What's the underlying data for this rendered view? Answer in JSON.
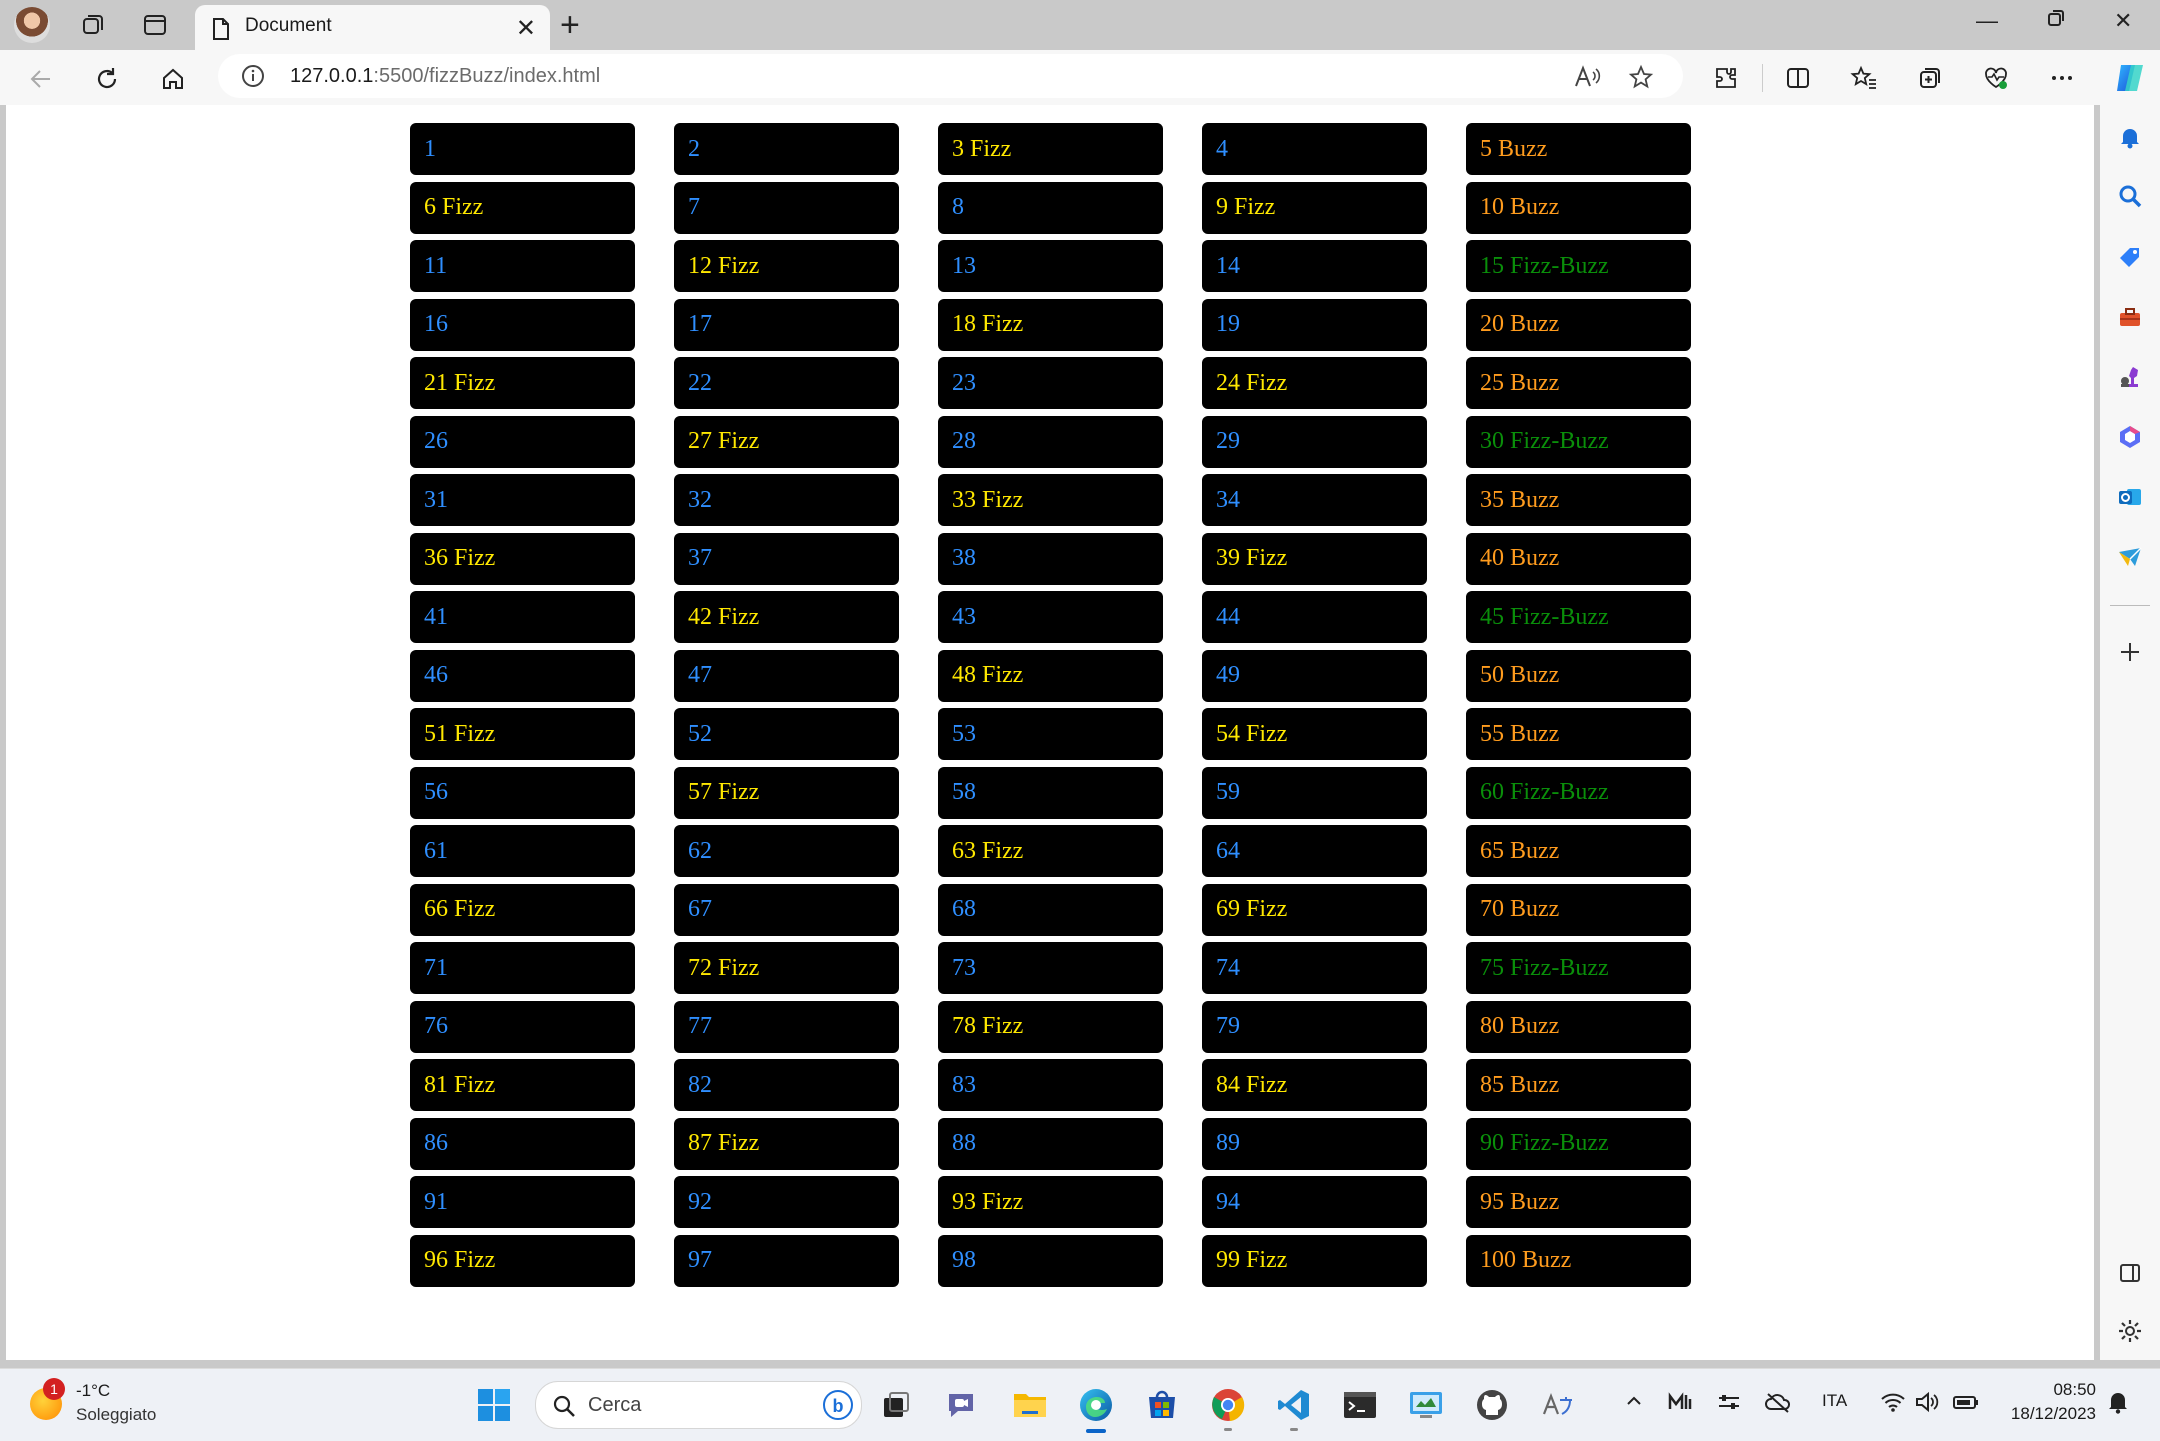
{
  "browser": {
    "tab_title": "Document",
    "url_host": "127.0.0.1",
    "url_path": ":5500/fizzBuzz/index.html"
  },
  "fizzbuzz": {
    "colors": {
      "number": "#2f8fff",
      "fizz": "#ffe800",
      "buzz": "#ff9c1e",
      "fizzbuzz": "#0a8f0a"
    },
    "columns": [
      [
        "1",
        "6 Fizz",
        "11",
        "16",
        "21 Fizz",
        "26",
        "31",
        "36 Fizz",
        "41",
        "46",
        "51 Fizz",
        "56",
        "61",
        "66 Fizz",
        "71",
        "76",
        "81 Fizz",
        "86",
        "91",
        "96 Fizz"
      ],
      [
        "2",
        "7",
        "12 Fizz",
        "17",
        "22",
        "27 Fizz",
        "32",
        "37",
        "42 Fizz",
        "47",
        "52",
        "57 Fizz",
        "62",
        "67",
        "72 Fizz",
        "77",
        "82",
        "87 Fizz",
        "92",
        "97"
      ],
      [
        "3 Fizz",
        "8",
        "13",
        "18 Fizz",
        "23",
        "28",
        "33 Fizz",
        "38",
        "43",
        "48 Fizz",
        "53",
        "58",
        "63 Fizz",
        "68",
        "73",
        "78 Fizz",
        "83",
        "88",
        "93 Fizz",
        "98"
      ],
      [
        "4",
        "9 Fizz",
        "14",
        "19",
        "24 Fizz",
        "29",
        "34",
        "39 Fizz",
        "44",
        "49",
        "54 Fizz",
        "59",
        "64",
        "69 Fizz",
        "74",
        "79",
        "84 Fizz",
        "89",
        "94",
        "99 Fizz"
      ],
      [
        "5 Buzz",
        "10 Buzz",
        "15 Fizz-Buzz",
        "20 Buzz",
        "25 Buzz",
        "30 Fizz-Buzz",
        "35 Buzz",
        "40 Buzz",
        "45 Fizz-Buzz",
        "50 Buzz",
        "55 Buzz",
        "60 Fizz-Buzz",
        "65 Buzz",
        "70 Buzz",
        "75 Fizz-Buzz",
        "80 Buzz",
        "85 Buzz",
        "90 Fizz-Buzz",
        "95 Buzz",
        "100 Buzz"
      ]
    ]
  },
  "taskbar": {
    "weather_badge": "1",
    "temperature": "-1°C",
    "condition": "Soleggiato",
    "search_placeholder": "Cerca",
    "language": "ITA",
    "time": "08:50",
    "date": "18/12/2023"
  }
}
